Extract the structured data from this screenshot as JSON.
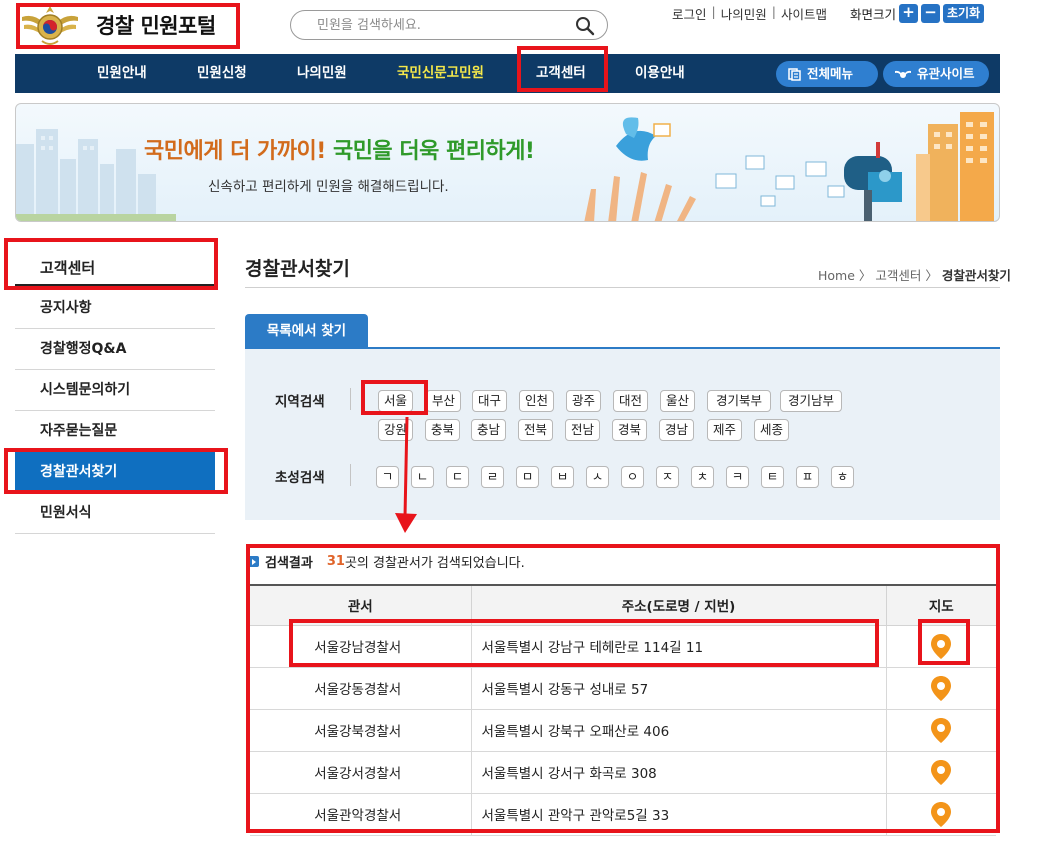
{
  "header": {
    "logo_text": "경찰 민원포털",
    "search_placeholder": "민원을 검색하세요.",
    "links": [
      "로그인",
      "나의민원",
      "사이트맵"
    ],
    "font_size_label": "화면크기",
    "font_plus": "+",
    "font_minus": "−",
    "font_reset": "초기화"
  },
  "nav": {
    "items": [
      "민원안내",
      "민원신청",
      "나의민원",
      "국민신문고민원",
      "고객센터",
      "이용안내"
    ],
    "highlight_index": 3,
    "all_menu": "전체메뉴",
    "related_sites": "유관사이트"
  },
  "banner": {
    "title_part1": "국민에게 더 가까이!",
    "title_part2": "국민을 더욱 편리하게!",
    "subtitle": "신속하고 편리하게 민원을 해결해드립니다."
  },
  "sidebar": {
    "heading": "고객센터",
    "items": [
      "공지사항",
      "경찰행정Q&A",
      "시스템문의하기",
      "자주묻는질문",
      "경찰관서찾기",
      "민원서식"
    ],
    "active_index": 4
  },
  "content": {
    "page_title": "경찰관서찾기",
    "breadcrumb": [
      "Home",
      "고객센터",
      "경찰관서찾기"
    ],
    "tab_label": "목록에서 찾기",
    "region_label": "지역검색",
    "regions_row1": [
      "서울",
      "부산",
      "대구",
      "인천",
      "광주",
      "대전",
      "울산",
      "경기북부",
      "경기남부"
    ],
    "regions_row2": [
      "강원",
      "충북",
      "충남",
      "전북",
      "전남",
      "경북",
      "경남",
      "제주",
      "세종"
    ],
    "initial_label": "초성검색",
    "initials": [
      "ㄱ",
      "ㄴ",
      "ㄷ",
      "ㄹ",
      "ㅁ",
      "ㅂ",
      "ㅅ",
      "ㅇ",
      "ㅈ",
      "ㅊ",
      "ㅋ",
      "ㅌ",
      "ㅍ",
      "ㅎ"
    ]
  },
  "results": {
    "label": "검색결과",
    "count": "31",
    "suffix": "곳의 경찰관서가 검색되었습니다.",
    "columns": [
      "관서",
      "주소(도로명 / 지번)",
      "지도"
    ],
    "rows": [
      {
        "name": "서울강남경찰서",
        "address": "서울특별시 강남구 테헤란로 114길 11"
      },
      {
        "name": "서울강동경찰서",
        "address": "서울특별시 강동구 성내로 57"
      },
      {
        "name": "서울강북경찰서",
        "address": "서울특별시 강북구 오패산로 406"
      },
      {
        "name": "서울강서경찰서",
        "address": "서울특별시 강서구 화곡로 308"
      },
      {
        "name": "서울관악경찰서",
        "address": "서울특별시 관악구 관악로5길 33"
      }
    ]
  },
  "colors": {
    "nav_bg": "#0e3a66",
    "accent_blue": "#2c7bc6",
    "highlight_red": "#e8141b",
    "pin_orange": "#f39419"
  },
  "icons": {
    "search": "search-icon",
    "map_pin": "map-pin-icon",
    "menu": "menu-icon",
    "emblem": "police-emblem-icon"
  }
}
